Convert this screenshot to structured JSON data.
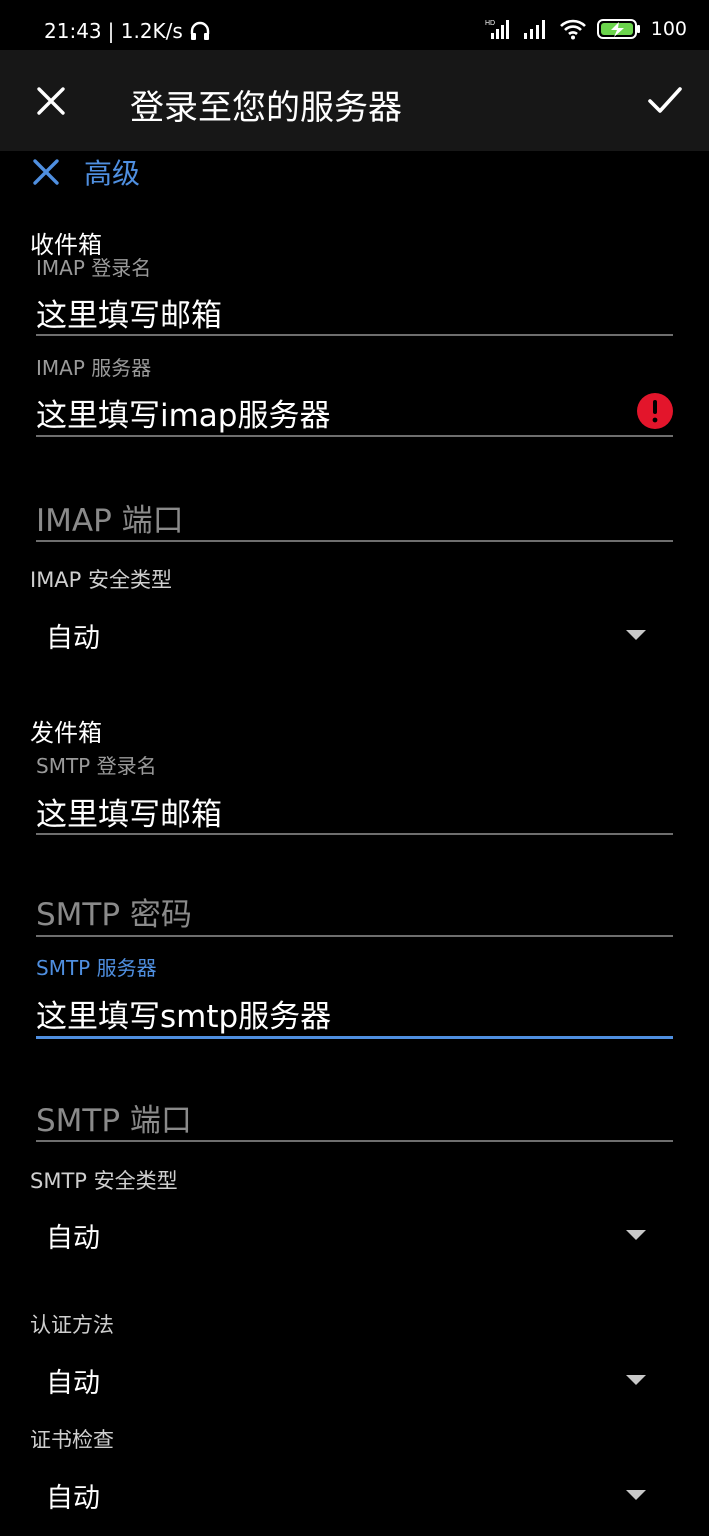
{
  "status": {
    "time": "21:43",
    "speed": "| 1.2K/s",
    "battery": "100",
    "icons": [
      "headphones-icon",
      "hd-signal-icon",
      "signal-icon",
      "wifi-icon",
      "battery-charging-icon"
    ]
  },
  "appbar": {
    "title": "登录至您的服务器"
  },
  "advanced": {
    "label": "高级"
  },
  "inbox": {
    "section": "收件箱",
    "login_label": "IMAP 登录名",
    "login_value": "这里填写邮箱",
    "server_label": "IMAP 服务器",
    "server_value": "这里填写imap服务器",
    "port_placeholder": "IMAP 端口",
    "security_label": "IMAP 安全类型",
    "security_value": "自动"
  },
  "outbox": {
    "section": "发件箱",
    "login_label": "SMTP 登录名",
    "login_value": "这里填写邮箱",
    "password_placeholder": "SMTP 密码",
    "server_label": "SMTP 服务器",
    "server_value": "这里填写smtp服务器",
    "port_placeholder": "SMTP 端口",
    "security_label": "SMTP 安全类型",
    "security_value": "自动"
  },
  "auth": {
    "label": "认证方法",
    "value": "自动"
  },
  "cert": {
    "label": "证书检查",
    "value": "自动"
  },
  "colors": {
    "accent": "#4f8fe0",
    "error": "#e3152b",
    "background": "#000000",
    "appbar": "#171717"
  }
}
